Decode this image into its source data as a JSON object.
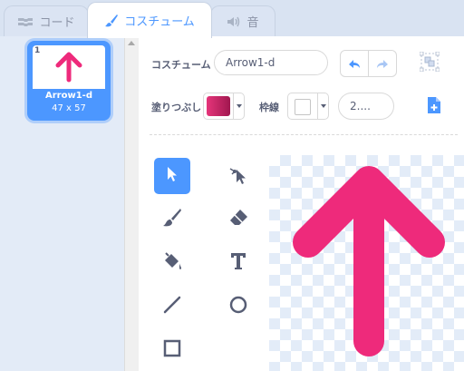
{
  "tabs": {
    "code": "コード",
    "costumes": "コスチューム",
    "sounds": "音"
  },
  "costume_list": {
    "items": [
      {
        "number": "1",
        "name": "Arrow1-d",
        "size": "47 x 57"
      }
    ]
  },
  "editor": {
    "costume_label": "コスチューム",
    "costume_name": "Arrow1-d",
    "fill_label": "塗りつぶし",
    "outline_label": "枠線",
    "outline_width": "2....",
    "fill_color": "#e6357a",
    "outline_color": "#ffffff"
  },
  "tools": [
    {
      "name": "select",
      "active": true
    },
    {
      "name": "reshape",
      "active": false
    },
    {
      "name": "brush",
      "active": false
    },
    {
      "name": "eraser",
      "active": false
    },
    {
      "name": "fill",
      "active": false
    },
    {
      "name": "text",
      "active": false
    },
    {
      "name": "line",
      "active": false
    },
    {
      "name": "circle",
      "active": false
    },
    {
      "name": "rectangle",
      "active": false
    }
  ],
  "colors": {
    "accent": "#4c97ff",
    "arrow": "#ee2a7b"
  }
}
